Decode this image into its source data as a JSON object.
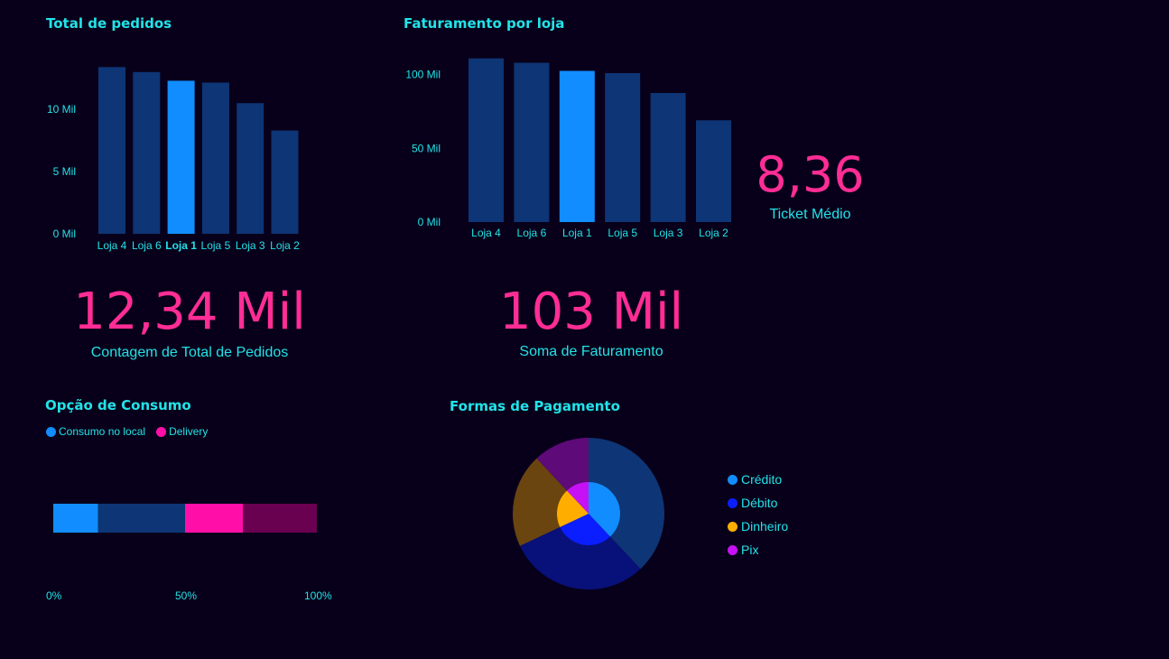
{
  "colors": {
    "background": "#08001a",
    "accent_text": "#22e3e8",
    "kpi": "#ff2d95",
    "bar_dim": "#0e3575",
    "bar_highlight": "#118dff"
  },
  "orders": {
    "title": "Total de pedidos",
    "yticks": [
      "0 Mil",
      "5 Mil",
      "10 Mil"
    ],
    "highlight": "Loja 1"
  },
  "revenue": {
    "title": "Faturamento por loja",
    "yticks": [
      "0 Mil",
      "50 Mil",
      "100 Mil"
    ],
    "highlight": "Loja 1"
  },
  "kpis": {
    "ticket_value": "8,36",
    "ticket_label": "Ticket Médio",
    "orders_value": "12,34 Mil",
    "orders_label": "Contagem de Total de Pedidos",
    "revenue_value": "103 Mil",
    "revenue_label": "Soma de Faturamento"
  },
  "consumption": {
    "title": "Opção de Consumo",
    "legend": [
      {
        "label": "Consumo no local",
        "color": "#118dff"
      },
      {
        "label": "Delivery",
        "color": "#ff0fa8"
      }
    ],
    "axis": [
      "0%",
      "50%",
      "100%"
    ]
  },
  "payment": {
    "title": "Formas de Pagamento",
    "legend": [
      {
        "label": "Crédito",
        "color": "#118dff"
      },
      {
        "label": "Débito",
        "color": "#0a1eff"
      },
      {
        "label": "Dinheiro",
        "color": "#ffae00"
      },
      {
        "label": "Pix",
        "color": "#c711f5"
      }
    ]
  },
  "chart_data": [
    {
      "type": "bar",
      "title": "Total de pedidos",
      "categories": [
        "Loja 4",
        "Loja 6",
        "Loja 1",
        "Loja 5",
        "Loja 3",
        "Loja 2"
      ],
      "values": [
        13400,
        13000,
        12300,
        12150,
        10500,
        8300
      ],
      "ylim": [
        0,
        14000
      ],
      "yticks": [
        0,
        5000,
        10000
      ],
      "grid": false
    },
    {
      "type": "bar",
      "title": "Faturamento por loja",
      "categories": [
        "Loja 4",
        "Loja 6",
        "Loja 1",
        "Loja 5",
        "Loja 3",
        "Loja 2"
      ],
      "values": [
        111000,
        108000,
        102500,
        101000,
        87500,
        69000
      ],
      "ylim": [
        0,
        112000
      ],
      "yticks": [
        0,
        50000,
        100000
      ],
      "grid": false
    },
    {
      "type": "bar",
      "title": "Opção de Consumo",
      "orientation": "horizontal-stacked",
      "series": [
        {
          "name": "Consumo no local",
          "values": [
            50
          ]
        },
        {
          "name": "Delivery",
          "values": [
            50
          ]
        }
      ],
      "highlight_fraction": [
        0.17,
        0.22
      ],
      "xlim": [
        0,
        100
      ]
    },
    {
      "type": "pie",
      "title": "Formas de Pagamento",
      "categories": [
        "Crédito",
        "Débito",
        "Dinheiro",
        "Pix"
      ],
      "values": [
        38,
        30,
        20,
        12
      ],
      "highlight_values": [
        38,
        30,
        20,
        12
      ]
    }
  ]
}
